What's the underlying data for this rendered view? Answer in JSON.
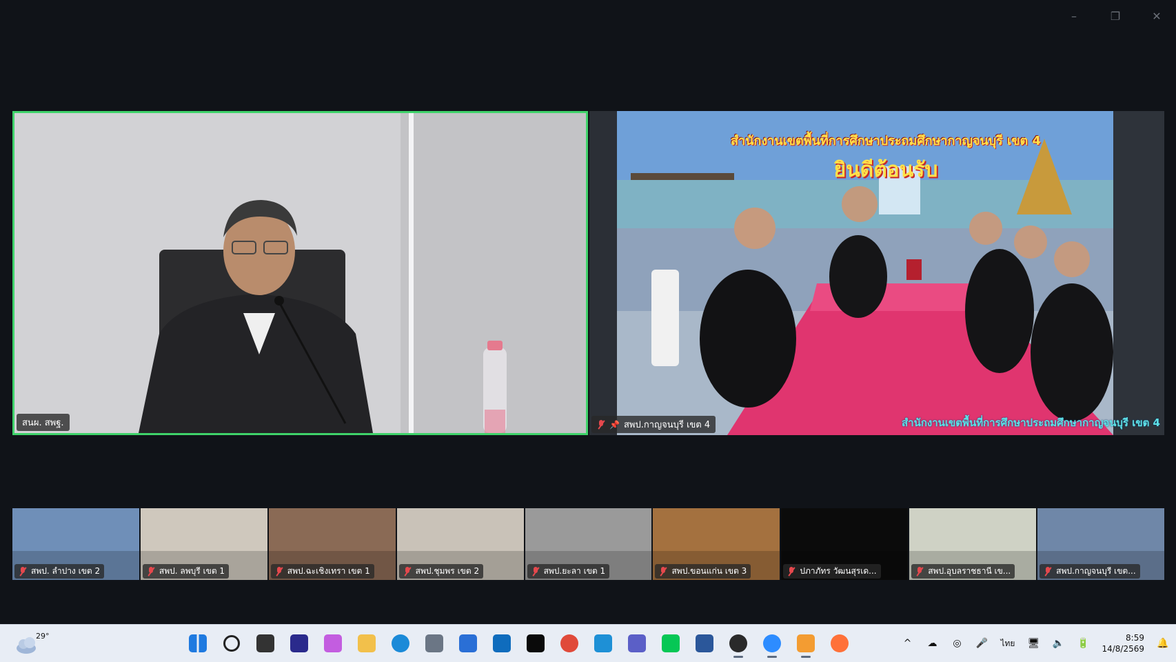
{
  "window": {
    "controls": [
      "–",
      "❐",
      "✕"
    ]
  },
  "main_tiles": [
    {
      "name": "สนผ. สพฐ.",
      "muted": false,
      "pinned": false
    },
    {
      "name": "สพป.กาญจนบุรี เขต 4",
      "muted": true,
      "pinned": true
    }
  ],
  "banner": {
    "title": "สำนักงานเขตพื้นที่การศึกษาประถมศึกษากาญจนบุรี เขต 4",
    "welcome": "ยินดีต้อนรับ",
    "caption": "สำนักงานเขตพื้นที่การศึกษาประถมศึกษากาญจนบุรี เขต 4"
  },
  "thumbnails": [
    {
      "name": "สพป. ลำปาง เขต 2",
      "muted": true,
      "bg": "#6f8fb8"
    },
    {
      "name": "สพป. ลพบุรี เขต 1",
      "muted": true,
      "bg": "#cfc8bd"
    },
    {
      "name": "สพป.ฉะเชิงเทรา เขต 1",
      "muted": true,
      "bg": "#8a6a55"
    },
    {
      "name": "สพป.ชุมพร เขต 2",
      "muted": true,
      "bg": "#c9c2b8"
    },
    {
      "name": "สพป.ยะลา เขต 1",
      "muted": true,
      "bg": "#9a9a9a"
    },
    {
      "name": "สพป.ขอนแก่น เขต 3",
      "muted": true,
      "bg": "#a4713f"
    },
    {
      "name": "ปภาภัทร วัฒนสุรเด...",
      "muted": true,
      "bg": "#0b0b0b"
    },
    {
      "name": "สพป.อุบลราชธานี เข...",
      "muted": true,
      "bg": "#cfd2c5"
    },
    {
      "name": "สพป.กาญจนบุรี เขต...",
      "muted": true,
      "bg": "#6f87a8"
    }
  ],
  "taskbar": {
    "temperature": "29°",
    "apps": [
      {
        "name": "start",
        "color": "#1f7ae0"
      },
      {
        "name": "search",
        "color": "#222222"
      },
      {
        "name": "task-view",
        "color": "#333333"
      },
      {
        "name": "webex",
        "color": "#2a2a8c"
      },
      {
        "name": "copilot",
        "color": "#c35de0"
      },
      {
        "name": "file-explorer",
        "color": "#f2c04b"
      },
      {
        "name": "edge",
        "color": "#1b8ad8"
      },
      {
        "name": "settings",
        "color": "#6b7685"
      },
      {
        "name": "store",
        "color": "#2a6fd6"
      },
      {
        "name": "outlook",
        "color": "#0f6cbd"
      },
      {
        "name": "dropbox",
        "color": "#0a0a0a"
      },
      {
        "name": "chrome",
        "color": "#e04a3a"
      },
      {
        "name": "clock-app",
        "color": "#1e90d6"
      },
      {
        "name": "teams",
        "color": "#5b5fc7"
      },
      {
        "name": "line",
        "color": "#06c755"
      },
      {
        "name": "word",
        "color": "#2b579a"
      },
      {
        "name": "obs",
        "color": "#2a2a2a"
      },
      {
        "name": "zoom",
        "color": "#2d8cff"
      },
      {
        "name": "app-orange",
        "color": "#f39c32"
      },
      {
        "name": "firefox",
        "color": "#ff7139"
      }
    ],
    "active_apps": [
      "zoom",
      "app-orange",
      "obs"
    ],
    "tray": {
      "chevron": "^",
      "language": "ไทย",
      "time": "8:59",
      "date": "14/8/2569"
    }
  }
}
